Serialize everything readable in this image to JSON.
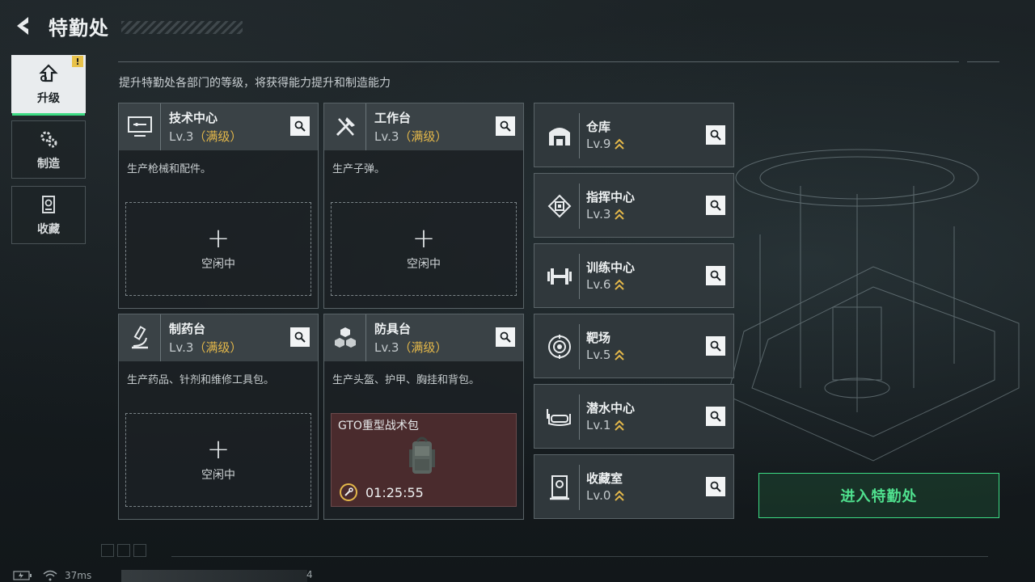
{
  "header": {
    "title": "特勤处"
  },
  "nav": {
    "tabs": [
      {
        "label": "升级",
        "icon": "upgrade-icon",
        "active": true,
        "alert": "!"
      },
      {
        "label": "制造",
        "icon": "gears-icon",
        "active": false
      },
      {
        "label": "收藏",
        "icon": "collection-icon",
        "active": false
      }
    ]
  },
  "subtitle": "提升特勤处各部门的等级，将获得能力提升和制造能力",
  "cards": [
    {
      "name": "技术中心",
      "level": "Lv.3",
      "max": "（满级）",
      "desc": "生产枪械和配件。",
      "slot": {
        "plus": "+",
        "label": "空闲中"
      }
    },
    {
      "name": "工作台",
      "level": "Lv.3",
      "max": "（满级）",
      "desc": "生产子弹。",
      "slot": {
        "plus": "+",
        "label": "空闲中"
      }
    },
    {
      "name": "制药台",
      "level": "Lv.3",
      "max": "（满级）",
      "desc": "生产药品、针剂和维修工具包。",
      "slot": {
        "plus": "+",
        "label": "空闲中"
      }
    },
    {
      "name": "防具台",
      "level": "Lv.3",
      "max": "（满级）",
      "desc": "生产头盔、护甲、胸挂和背包。",
      "craft": {
        "name": "GTO重型战术包",
        "timer": "01:25:55"
      }
    }
  ],
  "rows": [
    {
      "name": "仓库",
      "level": "Lv.9"
    },
    {
      "name": "指挥中心",
      "level": "Lv.3"
    },
    {
      "name": "训练中心",
      "level": "Lv.6"
    },
    {
      "name": "靶场",
      "level": "Lv.5"
    },
    {
      "name": "潜水中心",
      "level": "Lv.1"
    },
    {
      "name": "收藏室",
      "level": "Lv.0"
    }
  ],
  "enter_button": "进入特勤处",
  "status": {
    "ping": "37ms",
    "uid_tail": "4"
  },
  "colors": {
    "accent": "#3ddc84",
    "gold": "#e4b84a",
    "panel": "#30383c"
  }
}
